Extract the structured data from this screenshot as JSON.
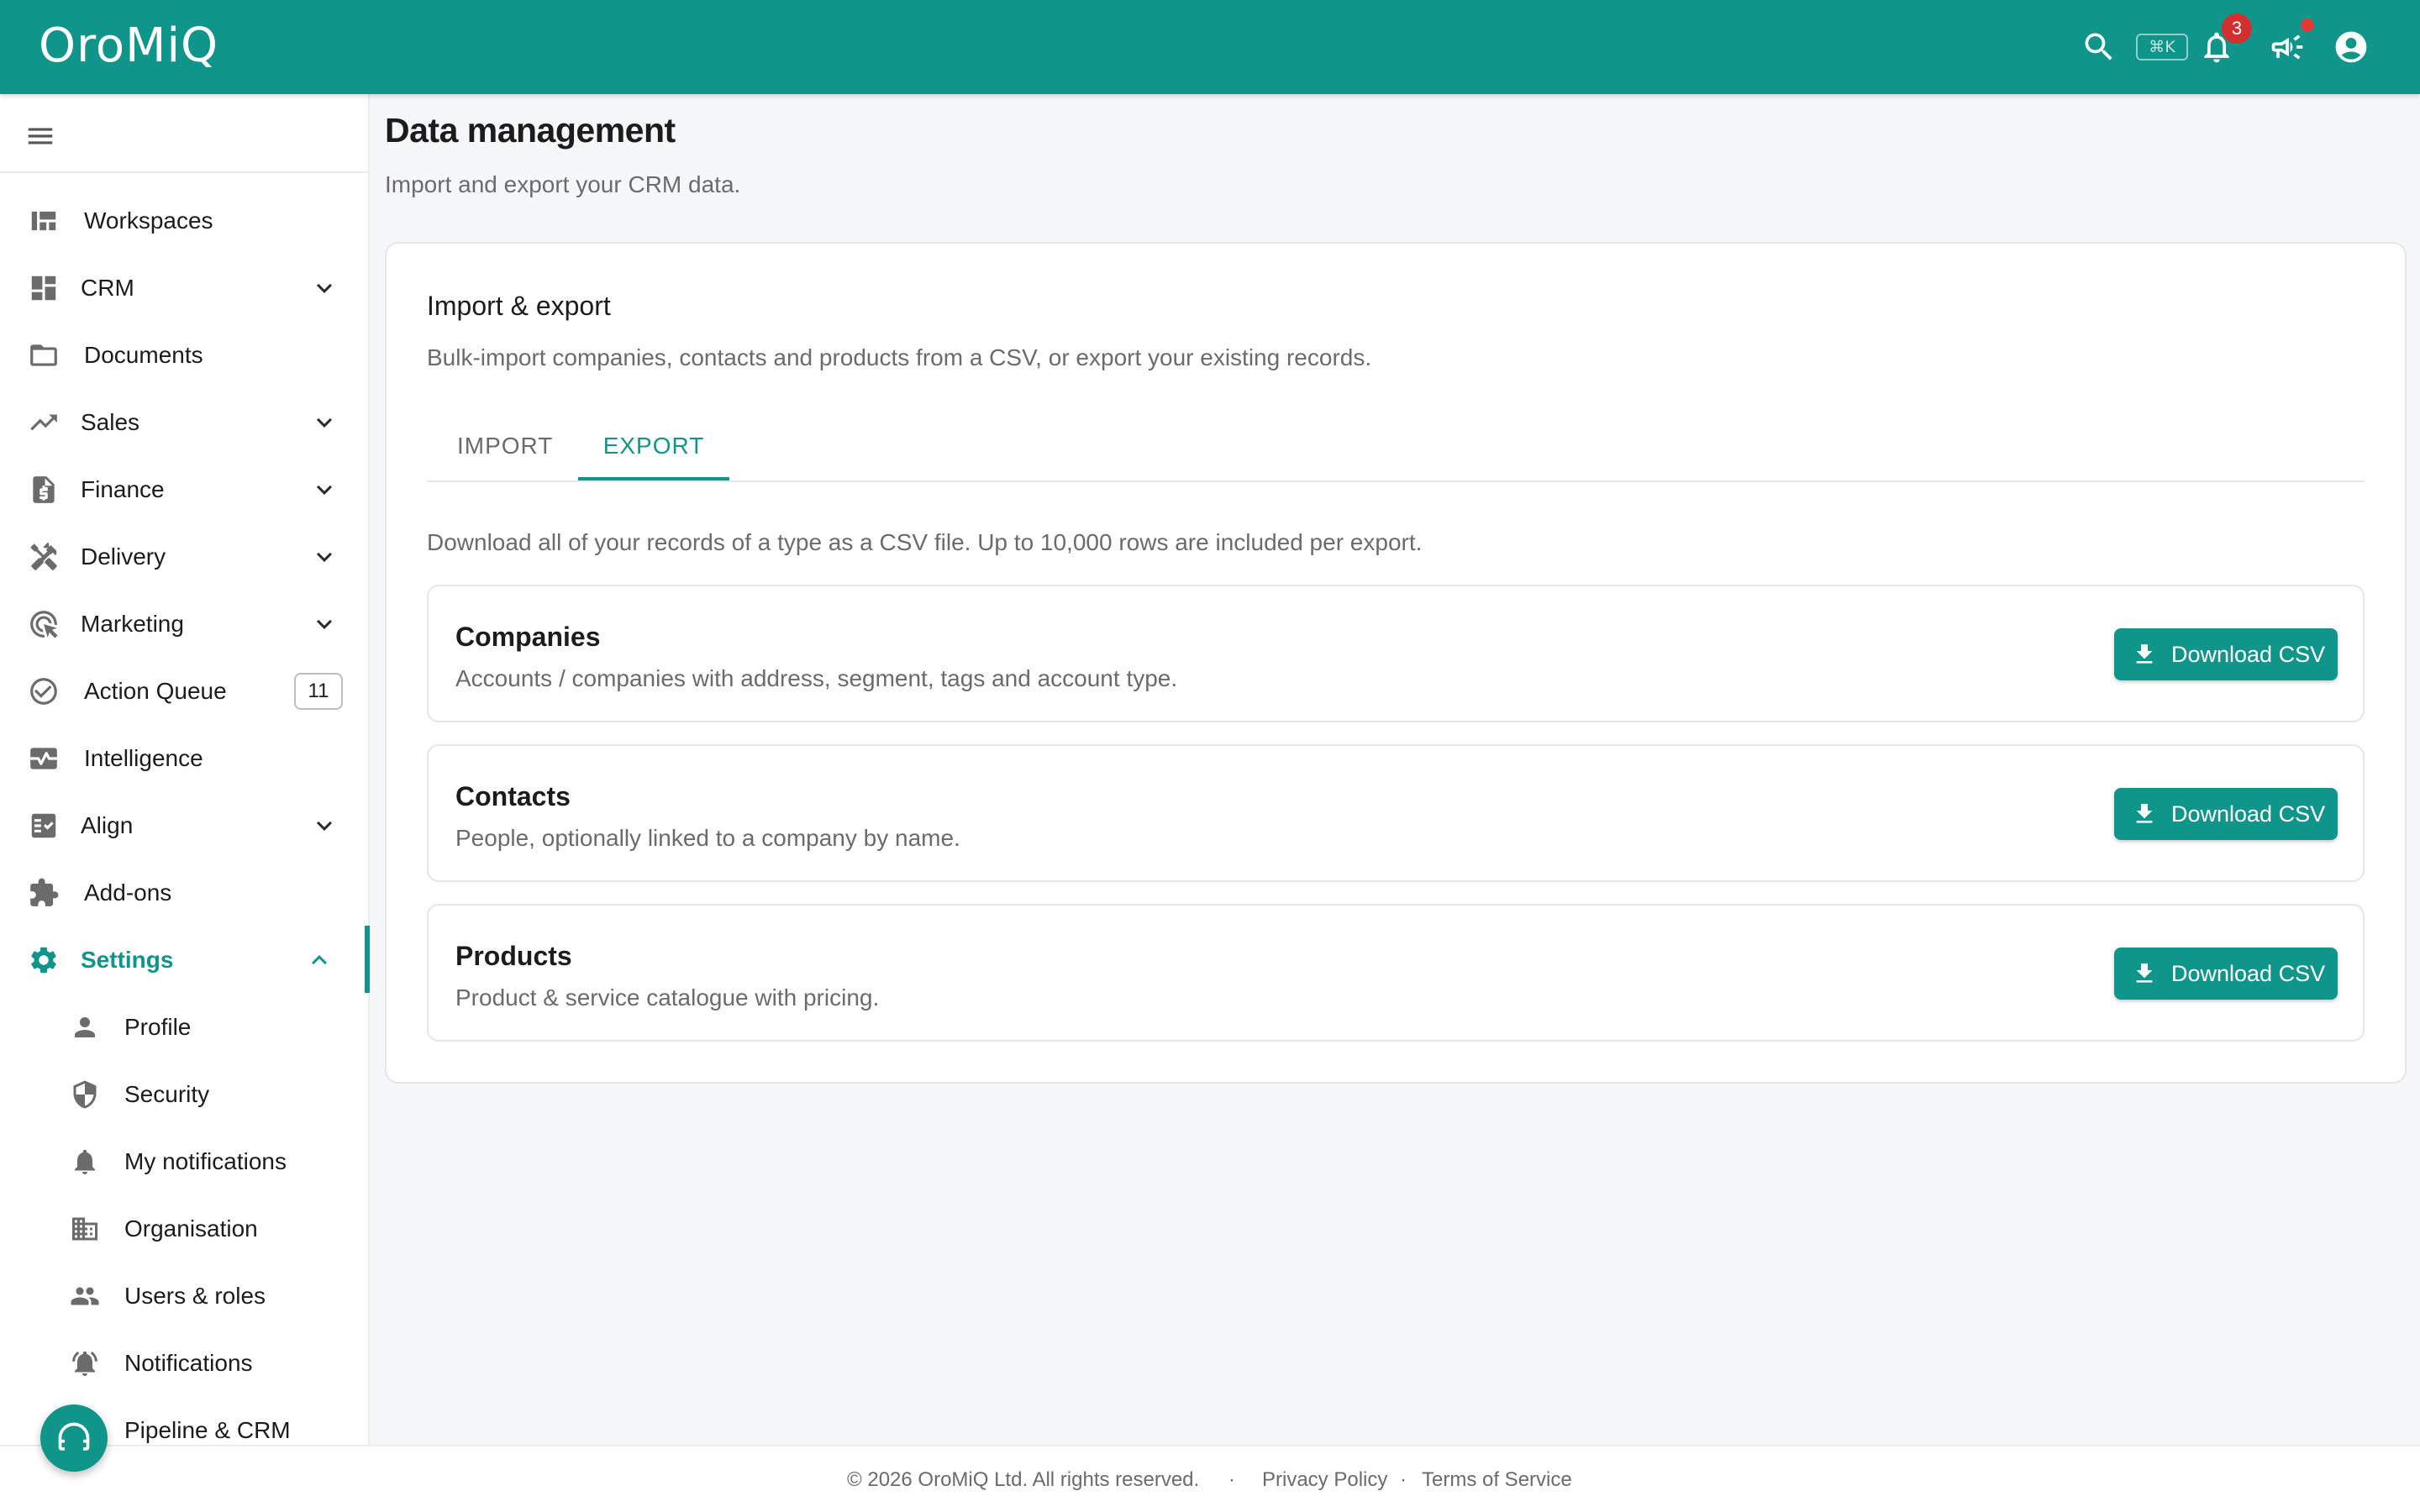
{
  "app": {
    "logo": "OroMiQ"
  },
  "topbar": {
    "shortcut": "⌘K",
    "notification_count": "3",
    "accent_color": "#10958a",
    "icons": [
      "search-icon",
      "bell-icon",
      "megaphone-icon",
      "account-circle-icon"
    ]
  },
  "sidebar": {
    "items": [
      {
        "label": "Workspaces",
        "icon": "dashboard-icon"
      },
      {
        "label": "CRM",
        "icon": "grid-icon"
      },
      {
        "label": "Documents",
        "icon": "folder-icon"
      },
      {
        "label": "Sales",
        "icon": "trending-up-icon"
      },
      {
        "label": "Finance",
        "icon": "invoice-icon"
      },
      {
        "label": "Delivery",
        "icon": "tools-icon"
      },
      {
        "label": "Marketing",
        "icon": "target-icon"
      },
      {
        "label": "Action Queue",
        "icon": "check-circle-icon",
        "count": "11"
      },
      {
        "label": "Intelligence",
        "icon": "monitor-heart-icon"
      },
      {
        "label": "Align",
        "icon": "checklist-icon"
      },
      {
        "label": "Add-ons",
        "icon": "puzzle-icon"
      },
      {
        "label": "Settings",
        "icon": "gear-icon"
      }
    ],
    "settings_sub": [
      {
        "label": "Profile",
        "icon": "person-icon"
      },
      {
        "label": "Security",
        "icon": "shield-icon"
      },
      {
        "label": "My notifications",
        "icon": "bell-icon"
      },
      {
        "label": "Organisation",
        "icon": "building-icon"
      },
      {
        "label": "Users & roles",
        "icon": "people-icon"
      },
      {
        "label": "Notifications",
        "icon": "bell-ring-icon"
      },
      {
        "label": "Pipeline & CRM",
        "icon": "pipeline-icon"
      }
    ]
  },
  "main": {
    "title": "Data management",
    "subtitle": "Import and export your CRM data.",
    "card": {
      "title": "Import & export",
      "subtitle": "Bulk-import companies, contacts and products from a CSV, or export your existing records.",
      "tabs": [
        {
          "label": "IMPORT",
          "active": false
        },
        {
          "label": "EXPORT",
          "active": true
        }
      ],
      "export_description": "Download all of your records of a type as a CSV file. Up to 10,000 rows are included per export.",
      "rows": [
        {
          "title": "Companies",
          "description": "Accounts / companies with address, segment, tags and account type.",
          "button": "Download CSV"
        },
        {
          "title": "Contacts",
          "description": "People, optionally linked to a company by name.",
          "button": "Download CSV"
        },
        {
          "title": "Products",
          "description": "Product & service catalogue with pricing.",
          "button": "Download CSV"
        }
      ]
    }
  },
  "footer": {
    "copyright": "© 2026 OroMiQ Ltd. All rights reserved.",
    "separator": "·",
    "privacy": "Privacy Policy",
    "terms": "Terms of Service"
  }
}
